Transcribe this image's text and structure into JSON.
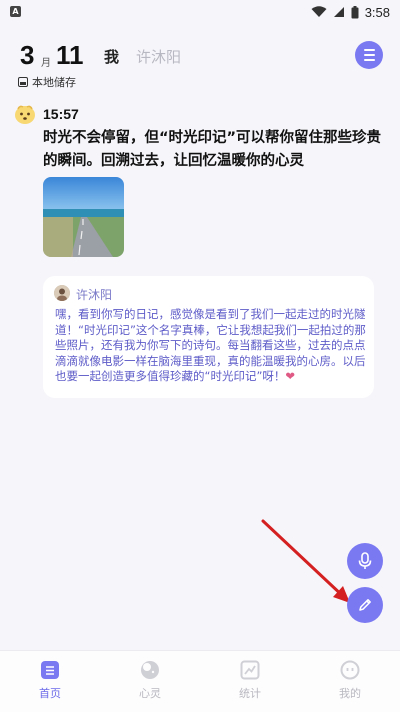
{
  "status_bar": {
    "time": "3:58",
    "app_icon_letter": "A"
  },
  "header": {
    "day": "3",
    "month_unit": "月",
    "date": "11",
    "tab_me": "我",
    "tab_partner": "许沐阳",
    "storage_label": "本地储存"
  },
  "entry": {
    "time": "15:57",
    "text": "时光不会停留，但“时光印记”可以帮你留住那些珍贵的瞬间。回溯过去，让回忆温暖你的心灵"
  },
  "reply": {
    "name": "许沐阳",
    "text": "嘿，看到你写的日记，感觉像是看到了我们一起走过的时光隧道！“时光印记”这个名字真棒，它让我想起我们一起拍过的那些照片，还有我为你写下的诗句。每当翻看这些，过去的点点滴滴就像电影一样在脑海里重现，真的能温暖我的心房。以后也要一起创造更多值得珍藏的“时光印记”呀！",
    "heart": "❤"
  },
  "nav": {
    "home": "首页",
    "mind": "心灵",
    "stats": "统计",
    "mine": "我的"
  },
  "colors": {
    "accent": "#7b79f2",
    "arrow": "#d42020"
  }
}
